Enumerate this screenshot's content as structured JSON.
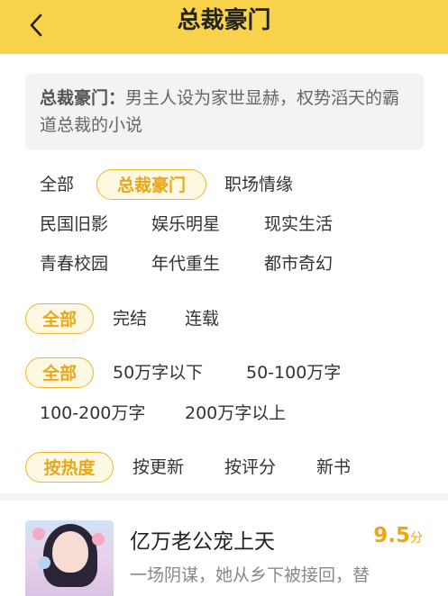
{
  "header": {
    "title": "总裁豪门",
    "back_icon": "chevron-left-icon",
    "bg_color": "#f8d24a"
  },
  "description": {
    "key": "总裁豪门：",
    "text": "男主人设为家世显赫，权势滔天的霸道总裁的小说"
  },
  "categories": [
    {
      "label": "全部"
    },
    {
      "label": "总裁豪门",
      "selected": true
    },
    {
      "label": "职场情缘"
    },
    {
      "label": "民国旧影"
    },
    {
      "label": "娱乐明星"
    },
    {
      "label": "现实生活"
    },
    {
      "label": "青春校园"
    },
    {
      "label": "年代重生"
    },
    {
      "label": "都市奇幻"
    }
  ],
  "status_filter": [
    {
      "label": "全部",
      "selected": true
    },
    {
      "label": "完结"
    },
    {
      "label": "连载"
    }
  ],
  "word_filter": [
    {
      "label": "全部",
      "selected": true
    },
    {
      "label": "50万字以下"
    },
    {
      "label": "50-100万字"
    },
    {
      "label": "100-200万字"
    },
    {
      "label": "200万字以上"
    }
  ],
  "sort_filter": [
    {
      "label": "按热度",
      "selected": true
    },
    {
      "label": "按更新"
    },
    {
      "label": "按评分"
    },
    {
      "label": "新书"
    }
  ],
  "book": {
    "title": "亿万老公宠上天",
    "score": "9.5",
    "score_unit": "分",
    "intro": "一场阴谋，她从乡下被接回，替",
    "accent_color": "#f0a70f"
  }
}
